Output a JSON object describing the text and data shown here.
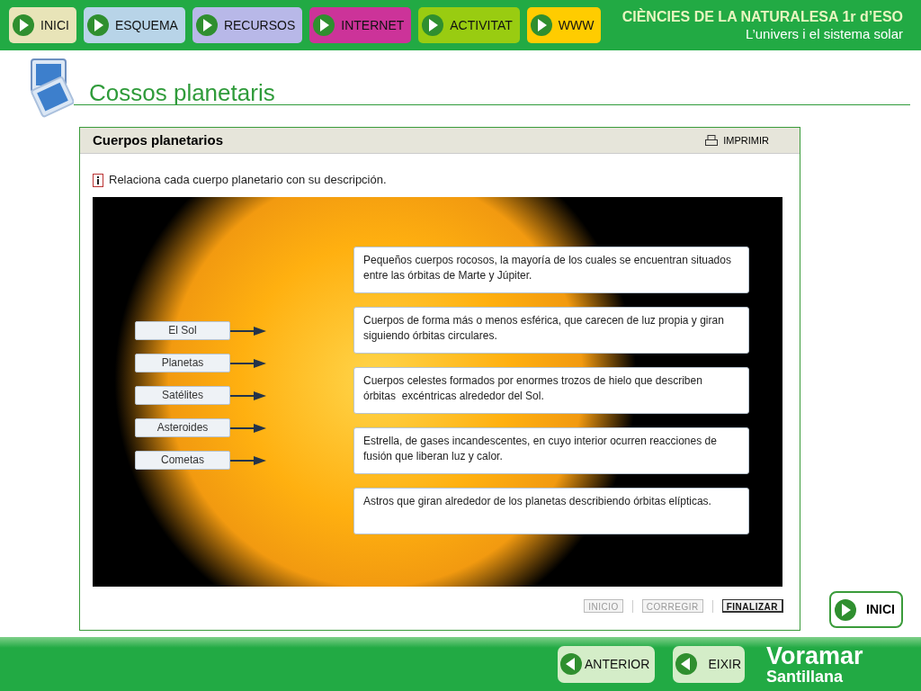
{
  "nav": [
    {
      "label": "INICI",
      "color": "#e8e4b8"
    },
    {
      "label": "ESQUEMA",
      "color": "#b8d4e8"
    },
    {
      "label": "RECURSOS",
      "color": "#b8b8e8"
    },
    {
      "label": "INTERNET",
      "color": "#cc3399"
    },
    {
      "label": "ACTIVITAT",
      "color": "#99cc11"
    },
    {
      "label": "WWW",
      "color": "#ffcc00"
    }
  ],
  "header": {
    "course": "CIÈNCIES DE LA NATURALESA 1r d’ESO",
    "unit": "L’univers i el sistema solar"
  },
  "page_title": "Cossos planetaris",
  "activity": {
    "title": "Cuerpos planetarios",
    "print": "IMPRIMIR",
    "instruction": "Relaciona cada cuerpo planetario con su descripción.",
    "terms": [
      "El Sol",
      "Planetas",
      "Satélites",
      "Asteroides",
      "Cometas"
    ],
    "descriptions": [
      "Pequeños cuerpos rocosos, la mayoría de los cuales se encuentran situados entre las órbitas de Marte y Júpiter.",
      "Cuerpos de forma más o menos esférica, que carecen de luz propia y giran siguiendo órbitas circulares.",
      "Cuerpos celestes formados por enormes trozos de hielo que describen  órbitas  excéntricas alrededor del Sol.",
      "Estrella, de gases incandescentes, en cuyo interior ocurren reacciones de fusión que liberan luz y calor.",
      "Astros que giran alrededor de los planetas describiendo órbitas elípticas."
    ],
    "actions": [
      {
        "label": "INICIO",
        "disabled": true
      },
      {
        "label": "CORREGIR",
        "disabled": true
      },
      {
        "label": "FINALIZAR",
        "disabled": false
      }
    ]
  },
  "home_button": "INICI",
  "footer": {
    "buttons": [
      "ANTERIOR",
      "EIXIR"
    ],
    "brand": "Voramar",
    "publisher": "Santillana"
  }
}
